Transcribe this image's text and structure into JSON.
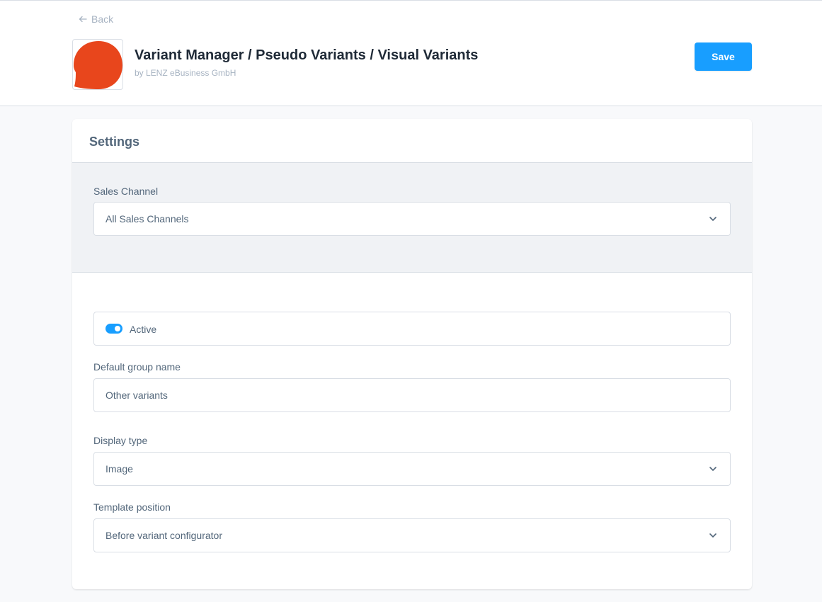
{
  "header": {
    "back_label": "Back",
    "app_title": "Variant Manager / Pseudo Variants / Visual Variants",
    "app_author": "by LENZ eBusiness GmbH",
    "save_label": "Save",
    "logo_color": "#e8461c"
  },
  "settings": {
    "title": "Settings",
    "sales_channel": {
      "label": "Sales Channel",
      "value": "All Sales Channels"
    },
    "active": {
      "label": "Active",
      "enabled": true
    },
    "default_group_name": {
      "label": "Default group name",
      "value": "Other variants"
    },
    "display_type": {
      "label": "Display type",
      "value": "Image"
    },
    "template_position": {
      "label": "Template position",
      "value": "Before variant configurator"
    }
  },
  "colors": {
    "primary": "#189eff",
    "text": "#52667a",
    "muted": "#a7b3c2",
    "border": "#d9dee5"
  }
}
